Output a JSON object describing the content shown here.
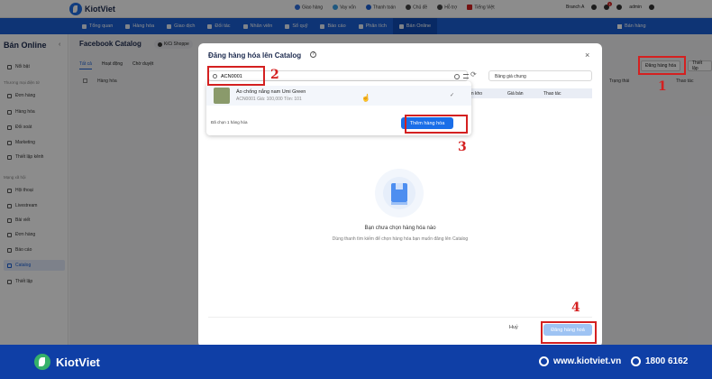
{
  "brand": {
    "name": "KiotViet"
  },
  "top_links": [
    "Giao hàng",
    "Vay vốn",
    "Thanh toán",
    "Chủ đề",
    "Hỗ trợ",
    "Tiếng Việt"
  ],
  "top_right": {
    "branch": "Branch A",
    "user": "admin",
    "notif_count": "1"
  },
  "nav": {
    "items": [
      "Tổng quan",
      "Hàng hóa",
      "Giao dịch",
      "Đối tác",
      "Nhân viên",
      "Sổ quỹ",
      "Báo cáo",
      "Phân tích",
      "Bán Online"
    ],
    "active": "Bán Online",
    "sell_label": "Bán hàng"
  },
  "sidebar": {
    "title": "Bán Online",
    "items_top": [
      "Nổi bật"
    ],
    "group1_label": "Thương mại điện tử",
    "group1": [
      "Đơn hàng",
      "Hàng hóa",
      "Đối soát",
      "Marketing",
      "Thiết lập kênh"
    ],
    "group2_label": "Mạng xã hội",
    "group2": [
      "Hội thoại",
      "Livestream",
      "Bài viết",
      "Đơn hàng",
      "Báo cáo",
      "Catalog",
      "Thiết lập"
    ],
    "active": "Catalog"
  },
  "page": {
    "title": "Facebook Catalog",
    "shop_chip": "KiCi Shoppe",
    "tabs": [
      "Tất cả",
      "Hoạt động",
      "Chờ duyệt"
    ],
    "table_headers": [
      "Hàng hóa",
      "Trạng thái",
      "Thao tác"
    ],
    "btn_register": "Đăng hàng hóa",
    "btn_settings": "Thiết lập"
  },
  "modal": {
    "title": "Đăng hàng hóa lên Catalog",
    "search_value": "ACN0001",
    "price_list": "Bảng giá chung",
    "grid_headers": [
      "Tồn kho",
      "Giá bán",
      "Thao tác"
    ],
    "result": {
      "name": "Áo chống nắng nam Umi Green",
      "meta": "ACN0001   Giá: 100,000   Tồn: 101"
    },
    "selected_text": "Đã chọn 1 hàng hóa",
    "add_button": "Thêm hàng hóa",
    "empty_title": "Bạn chưa chọn hàng hóa nào",
    "empty_subtitle": "Dùng thanh tìm kiếm để chọn hàng hóa bạn muốn đăng lên Catalog",
    "cancel_button": "Huỷ",
    "submit_button": "Đăng hàng hoá"
  },
  "annotations": [
    "1",
    "2",
    "3",
    "4"
  ],
  "banner": {
    "brand": "KiotViet",
    "website": "www.kiotviet.vn",
    "phone": "1800 6162"
  },
  "colors": {
    "primary": "#1a5fd6",
    "annotation": "#d42020",
    "banner": "#0f3fa6"
  }
}
